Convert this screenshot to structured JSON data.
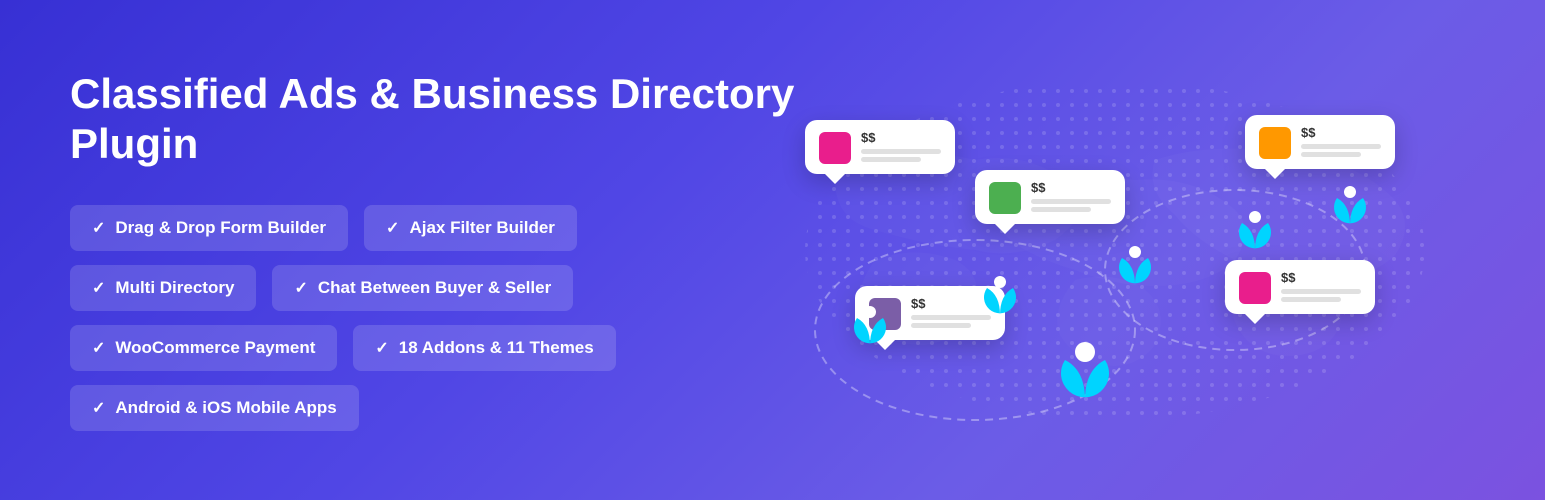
{
  "banner": {
    "title": "Classified Ads & Business Directory Plugin",
    "features": [
      {
        "row": [
          {
            "id": "drag-drop",
            "label": "Drag & Drop Form Builder"
          },
          {
            "id": "ajax-filter",
            "label": "Ajax Filter Builder"
          }
        ]
      },
      {
        "row": [
          {
            "id": "multi-dir",
            "label": "Multi Directory"
          },
          {
            "id": "chat",
            "label": "Chat Between Buyer & Seller"
          }
        ]
      },
      {
        "row": [
          {
            "id": "woocommerce",
            "label": "WooCommerce Payment"
          },
          {
            "id": "addons",
            "label": "18 Addons & 11 Themes"
          }
        ]
      },
      {
        "row": [
          {
            "id": "mobile-apps",
            "label": "Android & iOS Mobile Apps"
          }
        ]
      }
    ],
    "cards": [
      {
        "id": "card-1",
        "price": "$$",
        "color": "#e91e8c"
      },
      {
        "id": "card-2",
        "price": "$$",
        "color": "#4caf50"
      },
      {
        "id": "card-3",
        "price": "$$",
        "color": "#ff9800"
      },
      {
        "id": "card-4",
        "price": "$$",
        "color": "#e91e8c"
      },
      {
        "id": "card-5",
        "price": "$$",
        "color": "#7b5ea7"
      }
    ]
  }
}
